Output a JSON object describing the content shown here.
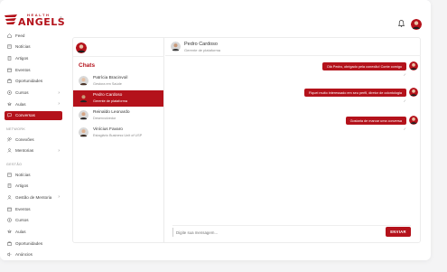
{
  "brand": {
    "small": "HEALTH",
    "big": "ANGELS",
    "mark": "®"
  },
  "sidebar": {
    "items_top": [
      {
        "label": "Feed",
        "icon": "home-icon"
      },
      {
        "label": "Notícias",
        "icon": "news-icon"
      },
      {
        "label": "Artigos",
        "icon": "article-icon"
      },
      {
        "label": "Eventos",
        "icon": "calendar-icon"
      },
      {
        "label": "Oportunidades",
        "icon": "opportunity-icon"
      },
      {
        "label": "Cursos",
        "icon": "course-icon"
      },
      {
        "label": "Aulas",
        "icon": "class-icon"
      },
      {
        "label": "Conversas",
        "icon": "chat-icon"
      }
    ],
    "section_network": "NETWORK",
    "items_network": [
      {
        "label": "Conexões",
        "icon": "connections-icon"
      },
      {
        "label": "Mentorias",
        "icon": "mentoring-icon"
      }
    ],
    "section_admin": "GESTÃO",
    "items_admin": [
      {
        "label": "Notícias",
        "icon": "news-icon"
      },
      {
        "label": "Artigos",
        "icon": "article-icon"
      },
      {
        "label": "Gestão de Mentoria",
        "icon": "mentor-mgmt-icon"
      },
      {
        "label": "Eventos",
        "icon": "calendar-icon"
      },
      {
        "label": "Cursos",
        "icon": "course-icon"
      },
      {
        "label": "Aulas",
        "icon": "class-icon"
      },
      {
        "label": "Oportunidades",
        "icon": "opportunity-icon"
      },
      {
        "label": "Anúncios",
        "icon": "ads-icon"
      }
    ]
  },
  "chats": {
    "title": "Chats",
    "contacts": [
      {
        "name": "Patrícia Bracinvoil",
        "role": "Gestora em Saúde"
      },
      {
        "name": "Pedro Cardoso",
        "role": "Gerente de plataforma"
      },
      {
        "name": "Reinaldo Leonardo",
        "role": "Desenvolvedor"
      },
      {
        "name": "Vinícius Favaro",
        "role": "Estagiário Business Unit of USP"
      }
    ]
  },
  "conversation": {
    "name": "Pedro Cardoso",
    "role": "Gerente de plataforma",
    "messages": [
      "Olá Pedro, obrigado pela conexão! Conte comigo",
      "Fiquei muito interessado em seu perfil, diretor de odontologia",
      "Gostaria de marcar uma conversa"
    ],
    "check_mark": "✓"
  },
  "composer": {
    "placeholder": "Digite sua mensagem...",
    "send": "ENVIAR"
  },
  "colors": {
    "accent": "#b4121b"
  }
}
